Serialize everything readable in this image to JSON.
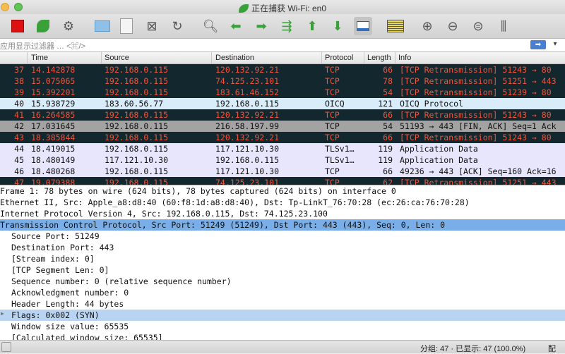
{
  "window": {
    "title": "正在捕获 Wi-Fi: en0"
  },
  "toolbar": {
    "buttons": [
      "stop-capture",
      "restart-capture",
      "capture-options",
      "open-file",
      "save-file",
      "close-file",
      "reload",
      "find-packet",
      "go-back",
      "go-forward",
      "go-to-packet",
      "go-first",
      "go-last",
      "auto-scroll",
      "colorize",
      "zoom-in",
      "zoom-out",
      "normal-size",
      "resize-columns"
    ]
  },
  "filter": {
    "placeholder": "应用显示过滤器 … <⌘/>",
    "apply_arrow": "➡",
    "dropdown": "▾"
  },
  "columns": [
    "Time",
    "Source",
    "Destination",
    "Protocol",
    "Length",
    "Info"
  ],
  "packets": [
    {
      "no": "37",
      "time": "14.142878",
      "src": "192.168.0.115",
      "dst": "120.132.92.21",
      "proto": "TCP",
      "len": "66",
      "info": "[TCP Retransmission] 51243 → 80",
      "style": "dark"
    },
    {
      "no": "38",
      "time": "15.075065",
      "src": "192.168.0.115",
      "dst": "74.125.23.101",
      "proto": "TCP",
      "len": "78",
      "info": "[TCP Retransmission] 51251 → 443",
      "style": "dark"
    },
    {
      "no": "39",
      "time": "15.392201",
      "src": "192.168.0.115",
      "dst": "183.61.46.152",
      "proto": "TCP",
      "len": "54",
      "info": "[TCP Retransmission] 51239 → 80",
      "style": "dark"
    },
    {
      "no": "40",
      "time": "15.938729",
      "src": "183.60.56.77",
      "dst": "192.168.0.115",
      "proto": "OICQ",
      "len": "121",
      "info": "OICQ Protocol",
      "style": "blue"
    },
    {
      "no": "41",
      "time": "16.264585",
      "src": "192.168.0.115",
      "dst": "120.132.92.21",
      "proto": "TCP",
      "len": "66",
      "info": "[TCP Retransmission] 51243 → 80",
      "style": "dark"
    },
    {
      "no": "42",
      "time": "17.031645",
      "src": "192.168.0.115",
      "dst": "216.58.197.99",
      "proto": "TCP",
      "len": "54",
      "info": "51193 → 443 [FIN, ACK] Seq=1 Ack",
      "style": "gray"
    },
    {
      "no": "43",
      "time": "18.385844",
      "src": "192.168.0.115",
      "dst": "120.132.92.21",
      "proto": "TCP",
      "len": "66",
      "info": "[TCP Retransmission] 51243 → 80",
      "style": "dark"
    },
    {
      "no": "44",
      "time": "18.419015",
      "src": "192.168.0.115",
      "dst": "117.121.10.30",
      "proto": "TLSv1…",
      "len": "119",
      "info": "Application Data",
      "style": "lav"
    },
    {
      "no": "45",
      "time": "18.480149",
      "src": "117.121.10.30",
      "dst": "192.168.0.115",
      "proto": "TLSv1…",
      "len": "119",
      "info": "Application Data",
      "style": "lav"
    },
    {
      "no": "46",
      "time": "18.480268",
      "src": "192.168.0.115",
      "dst": "117.121.10.30",
      "proto": "TCP",
      "len": "66",
      "info": "49236 → 443 [ACK] Seq=160 Ack=16",
      "style": "lav"
    },
    {
      "no": "47",
      "time": "19.079388",
      "src": "192.168.0.115",
      "dst": "74.125.23.101",
      "proto": "TCP",
      "len": "62",
      "info": "[TCP Retransmission] 51251 → 443",
      "style": "dark"
    }
  ],
  "details": [
    {
      "text": "Frame 1: 78 bytes on wire (624 bits), 78 bytes captured (624 bits) on interface 0",
      "indent": 0,
      "style": ""
    },
    {
      "text": "Ethernet II, Src: Apple_a8:d8:40 (60:f8:1d:a8:d8:40), Dst: Tp-LinkT_76:70:28 (ec:26:ca:76:70:28)",
      "indent": 0,
      "style": ""
    },
    {
      "text": "Internet Protocol Version 4, Src: 192.168.0.115, Dst: 74.125.23.100",
      "indent": 0,
      "style": ""
    },
    {
      "text": "Transmission Control Protocol, Src Port: 51249 (51249), Dst Port: 443 (443), Seq: 0, Len: 0",
      "indent": 0,
      "style": "sel"
    },
    {
      "text": "Source Port: 51249",
      "indent": 1,
      "style": ""
    },
    {
      "text": "Destination Port: 443",
      "indent": 1,
      "style": ""
    },
    {
      "text": "[Stream index: 0]",
      "indent": 1,
      "style": ""
    },
    {
      "text": "[TCP Segment Len: 0]",
      "indent": 1,
      "style": ""
    },
    {
      "text": "Sequence number: 0    (relative sequence number)",
      "indent": 1,
      "style": ""
    },
    {
      "text": "Acknowledgment number: 0",
      "indent": 1,
      "style": ""
    },
    {
      "text": "Header Length: 44 bytes",
      "indent": 1,
      "style": ""
    },
    {
      "text": "Flags: 0x002 (SYN)",
      "indent": 1,
      "style": "flags",
      "expander": "▶"
    },
    {
      "text": "Window size value: 65535",
      "indent": 1,
      "style": ""
    },
    {
      "text": "[Calculated window size: 65535]",
      "indent": 1,
      "style": ""
    }
  ],
  "status": {
    "text": "分组: 47 · 已显示: 47 (100.0%)",
    "profile": "配"
  },
  "colors": {
    "dark_row_bg": "#12272e",
    "dark_row_fg": "#f0553b",
    "selected": "#7aaee8"
  }
}
